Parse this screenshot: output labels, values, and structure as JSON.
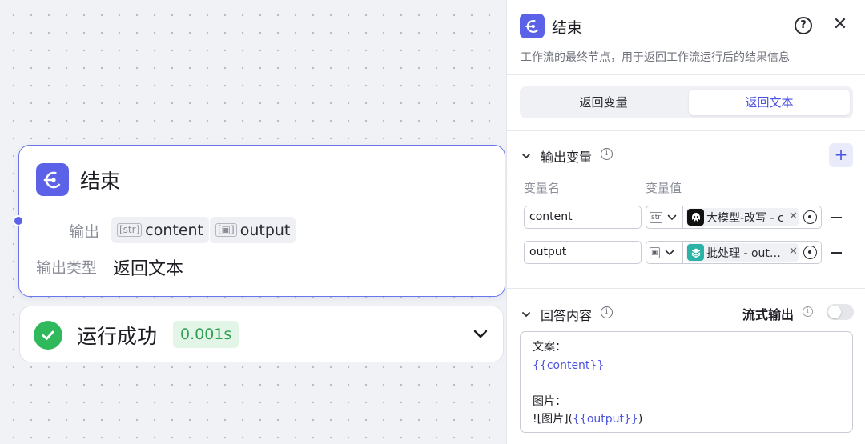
{
  "node": {
    "title": "结束",
    "output_label": "输出",
    "outputs": [
      {
        "type_tag": "[str]",
        "name": "content"
      },
      {
        "type_tag": "[▣]",
        "name": "output"
      }
    ],
    "output_type_label": "输出类型",
    "output_type_value": "返回文本"
  },
  "run_status": {
    "text": "运行成功",
    "time": "0.001s"
  },
  "panel": {
    "title": "结束",
    "help_icon": "?",
    "close_icon": "✕",
    "description": "工作流的最终节点，用于返回工作流运行后的结果信息",
    "tabs": [
      {
        "label": "返回变量",
        "active": false
      },
      {
        "label": "返回文本",
        "active": true
      }
    ],
    "output_section": {
      "title": "输出变量",
      "info": "i",
      "add": "+",
      "col_name": "变量名",
      "col_value": "变量值",
      "rows": [
        {
          "name": "content",
          "type_tag": "str",
          "ref_label": "大模型-改写 - c",
          "ref_icon": "llm-node-icon",
          "ref_color": "#111111"
        },
        {
          "name": "output",
          "type_tag": "▣",
          "ref_label": "批处理 - out…",
          "ref_icon": "batch-node-icon",
          "ref_color": "#2ab3a6"
        }
      ]
    },
    "answer_section": {
      "title": "回答内容",
      "info": "i",
      "stream_label": "流式输出",
      "stream_on": false,
      "lines": [
        {
          "plain": "文案：",
          "var": ""
        },
        {
          "plain": "",
          "var": "{{content}}"
        },
        {
          "plain": "",
          "var": ""
        },
        {
          "plain": "图片：",
          "var": ""
        },
        {
          "plain": "![图片](",
          "var": "{{output}}",
          "suffix": ")"
        }
      ]
    }
  },
  "colors": {
    "accent": "#5b62e8",
    "success": "#2fb85c"
  }
}
